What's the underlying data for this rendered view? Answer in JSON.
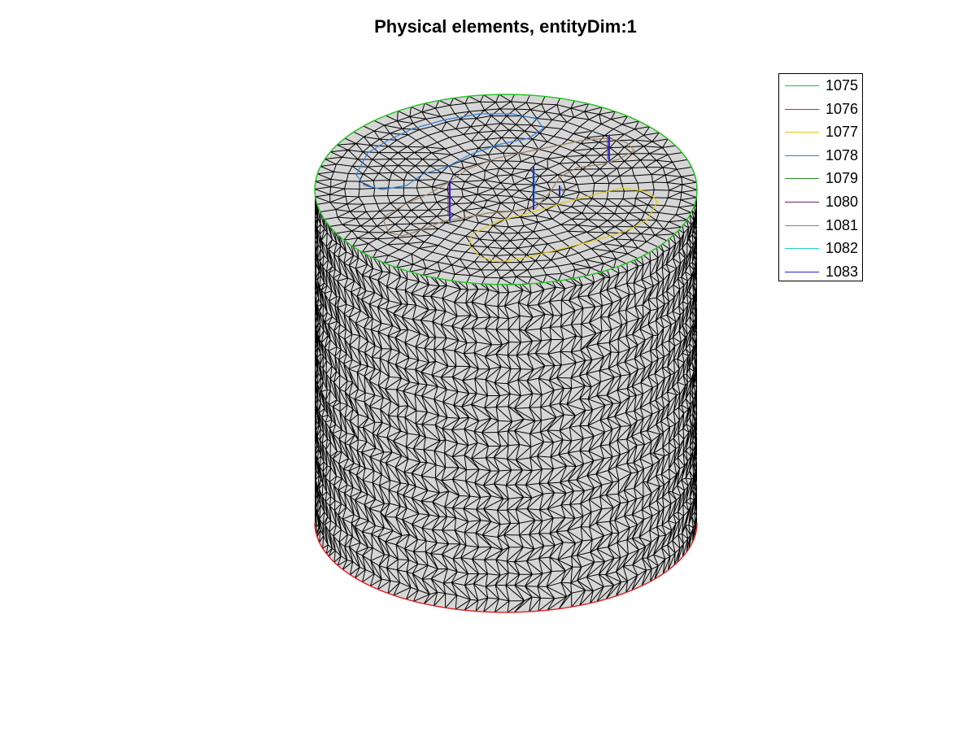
{
  "title": "Physical elements, entityDim:1",
  "colors": {
    "surface_fill": "#d6d6d6",
    "mesh_edge": "#000000"
  },
  "legend": [
    {
      "label": "1075",
      "color": "#22c422"
    },
    {
      "label": "1076",
      "color": "#e02020"
    },
    {
      "label": "1077",
      "color": "#e6c619"
    },
    {
      "label": "1078",
      "color": "#2f7fd8"
    },
    {
      "label": "1079",
      "color": "#2c8a2c"
    },
    {
      "label": "1080",
      "color": "#6e1f6e"
    },
    {
      "label": "1081",
      "color": "#9a8060"
    },
    {
      "label": "1082",
      "color": "#20d8c8"
    },
    {
      "label": "1083",
      "color": "#2222dd"
    }
  ]
}
